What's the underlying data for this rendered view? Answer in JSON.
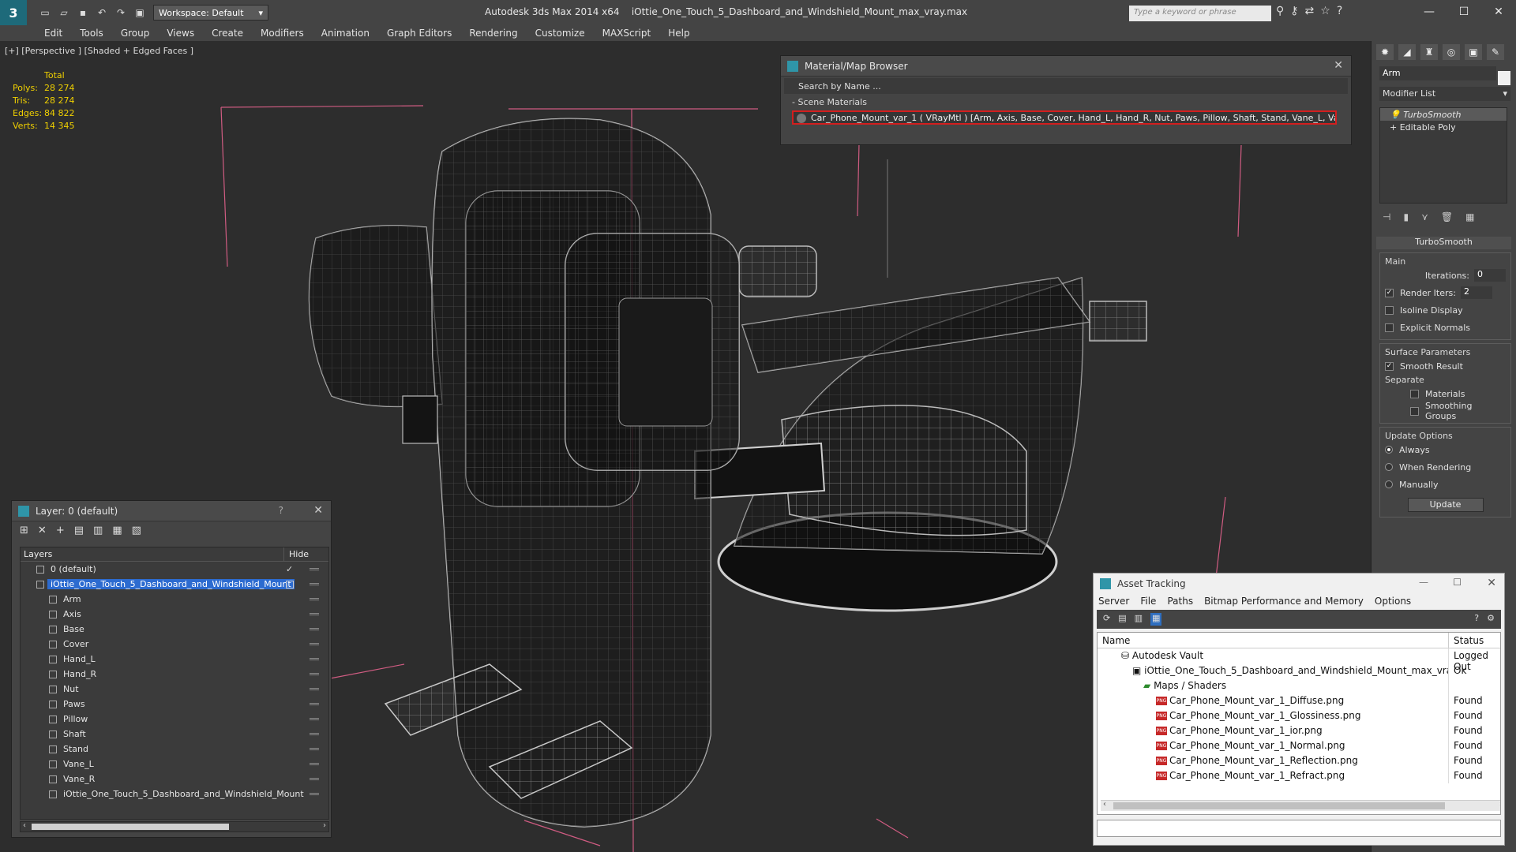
{
  "titlebar": {
    "app_title": "Autodesk 3ds Max  2014 x64",
    "file_name": "iOttie_One_Touch_5_Dashboard_and_Windshield_Mount_max_vray.max",
    "workspace": "Workspace: Default",
    "search_placeholder": "Type a keyword or phrase"
  },
  "menu": [
    "Edit",
    "Tools",
    "Group",
    "Views",
    "Create",
    "Modifiers",
    "Animation",
    "Graph Editors",
    "Rendering",
    "Customize",
    "MAXScript",
    "Help"
  ],
  "viewport": {
    "label": "[+] [Perspective ] [Shaded + Edged Faces ]",
    "stats": {
      "total_label": "Total",
      "rows": [
        {
          "k": "Polys:",
          "v": "28 274"
        },
        {
          "k": "Tris:",
          "v": "28 274"
        },
        {
          "k": "Edges:",
          "v": "84 822"
        },
        {
          "k": "Verts:",
          "v": "14 345"
        }
      ]
    }
  },
  "material_browser": {
    "title": "Material/Map Browser",
    "search": "Search by Name ...",
    "section": "Scene Materials",
    "material": "Car_Phone_Mount_var_1  ( VRayMtl ) [Arm, Axis, Base, Cover, Hand_L, Hand_R, Nut, Paws, Pillow, Shaft, Stand, Vane_L, Vane_R]"
  },
  "command_panel": {
    "object_name": "Arm",
    "modifier_list": "Modifier List",
    "stack": [
      "TurboSmooth",
      "Editable Poly"
    ],
    "rollout": "TurboSmooth",
    "main_label": "Main",
    "iterations_label": "Iterations:",
    "iterations": "0",
    "render_iters_label": "Render Iters:",
    "render_iters": "2",
    "isoline": "Isoline Display",
    "explicit": "Explicit Normals",
    "surface_label": "Surface Parameters",
    "smooth_result": "Smooth Result",
    "separate_label": "Separate",
    "materials": "Materials",
    "smoothing_groups": "Smoothing Groups",
    "update_label": "Update Options",
    "always": "Always",
    "when_rendering": "When Rendering",
    "manually": "Manually",
    "update_btn": "Update"
  },
  "layer_panel": {
    "title": "Layer: 0 (default)",
    "help": "?",
    "col_layers": "Layers",
    "col_hide": "Hide",
    "rows": [
      {
        "name": "0 (default)",
        "indent": 1
      },
      {
        "name": "iOttie_One_Touch_5_Dashboard_and_Windshield_Mount",
        "indent": 1
      },
      {
        "name": "Arm",
        "indent": 2
      },
      {
        "name": "Axis",
        "indent": 2
      },
      {
        "name": "Base",
        "indent": 2
      },
      {
        "name": "Cover",
        "indent": 2
      },
      {
        "name": "Hand_L",
        "indent": 2
      },
      {
        "name": "Hand_R",
        "indent": 2
      },
      {
        "name": "Nut",
        "indent": 2
      },
      {
        "name": "Paws",
        "indent": 2
      },
      {
        "name": "Pillow",
        "indent": 2
      },
      {
        "name": "Shaft",
        "indent": 2
      },
      {
        "name": "Stand",
        "indent": 2
      },
      {
        "name": "Vane_L",
        "indent": 2
      },
      {
        "name": "Vane_R",
        "indent": 2
      },
      {
        "name": "iOttie_One_Touch_5_Dashboard_and_Windshield_Mount",
        "indent": 2
      }
    ]
  },
  "asset_tracking": {
    "title": "Asset Tracking",
    "menu": [
      "Server",
      "File",
      "Paths",
      "Bitmap Performance and Memory",
      "Options"
    ],
    "col_name": "Name",
    "col_status": "Status",
    "rows": [
      {
        "name": "Autodesk Vault",
        "status": "Logged Out",
        "indent": 1
      },
      {
        "name": "iOttie_One_Touch_5_Dashboard_and_Windshield_Mount_max_vray.max",
        "status": "Ok",
        "indent": 2
      },
      {
        "name": "Maps / Shaders",
        "status": "",
        "indent": 3
      },
      {
        "name": "Car_Phone_Mount_var_1_Diffuse.png",
        "status": "Found",
        "indent": 4
      },
      {
        "name": "Car_Phone_Mount_var_1_Glossiness.png",
        "status": "Found",
        "indent": 4
      },
      {
        "name": "Car_Phone_Mount_var_1_ior.png",
        "status": "Found",
        "indent": 4
      },
      {
        "name": "Car_Phone_Mount_var_1_Normal.png",
        "status": "Found",
        "indent": 4
      },
      {
        "name": "Car_Phone_Mount_var_1_Reflection.png",
        "status": "Found",
        "indent": 4
      },
      {
        "name": "Car_Phone_Mount_var_1_Refract.png",
        "status": "Found",
        "indent": 4
      }
    ]
  },
  "colors": {
    "accent": "#2f95a8",
    "selection": "#2c6bd0",
    "stats": "#f0d000",
    "highlight_border": "#d31e1e"
  }
}
